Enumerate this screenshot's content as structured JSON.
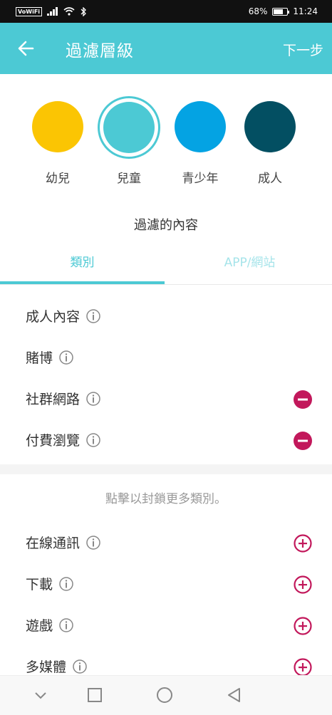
{
  "status_bar": {
    "carrier_badge": "VoWiFi",
    "battery_percent": "68%",
    "battery_level": 0.68,
    "time": "11:24"
  },
  "header": {
    "title": "過濾層級",
    "next_label": "下一步",
    "back_icon": "arrow-left-icon"
  },
  "levels": [
    {
      "label": "幼兒",
      "color": "#fbc503",
      "selected": false
    },
    {
      "label": "兒童",
      "color": "#4cc9d4",
      "selected": true
    },
    {
      "label": "青少年",
      "color": "#04a3e3",
      "selected": false
    },
    {
      "label": "成人",
      "color": "#034f62",
      "selected": false
    }
  ],
  "section_title": "過濾的內容",
  "tabs": [
    {
      "label": "類別",
      "active": true
    },
    {
      "label": "APP/網站",
      "active": false
    }
  ],
  "blocked_categories": [
    {
      "label": "成人內容",
      "action": "none"
    },
    {
      "label": "賭博",
      "action": "none"
    },
    {
      "label": "社群網路",
      "action": "remove"
    },
    {
      "label": "付費瀏覽",
      "action": "remove"
    }
  ],
  "hint": "點擊以封鎖更多類別。",
  "more_categories": [
    {
      "label": "在線通訊",
      "action": "add"
    },
    {
      "label": "下載",
      "action": "add"
    },
    {
      "label": "遊戲",
      "action": "add"
    },
    {
      "label": "多媒體",
      "action": "add"
    }
  ],
  "colors": {
    "accent": "#4cc9d4",
    "action": "#c2185b"
  },
  "nav_bar": [
    "back-chevron-icon",
    "square-icon",
    "circle-icon",
    "triangle-back-icon"
  ]
}
